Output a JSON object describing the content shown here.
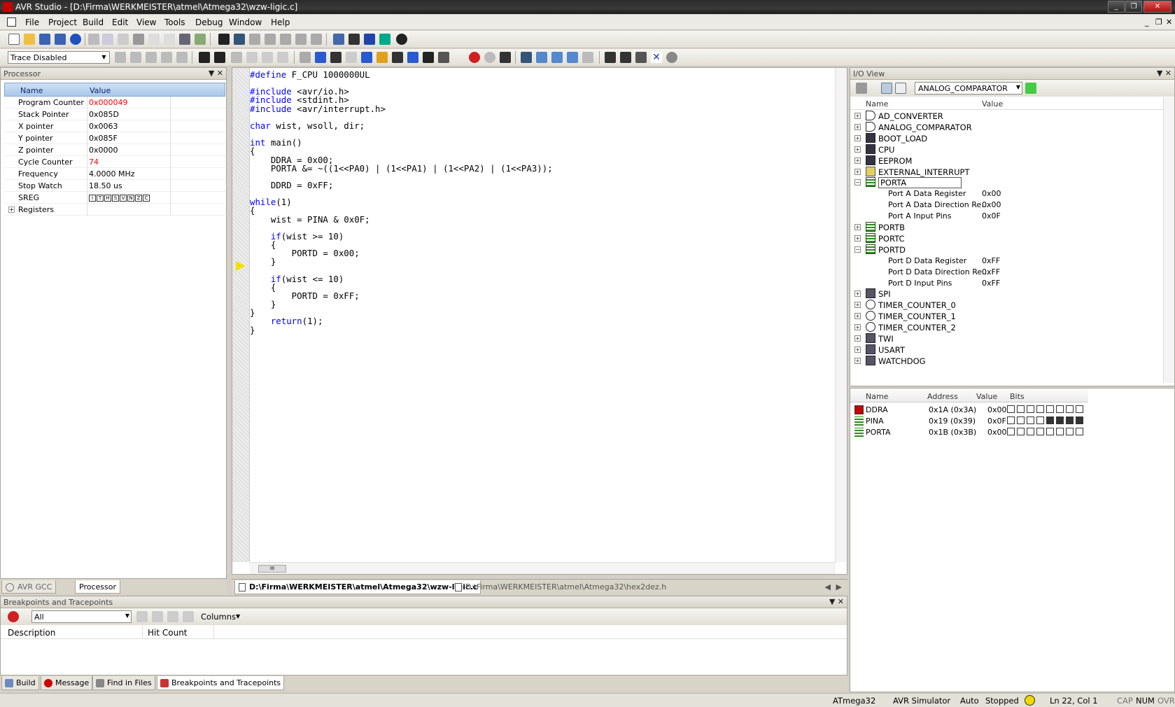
{
  "window": {
    "title": "AVR Studio - [D:\\Firma\\WERKMEISTER\\atmel\\Atmega32\\wzw-ligic.c]",
    "controls": [
      "_",
      "❐",
      "✕"
    ],
    "mdi_controls": [
      "_",
      "❐",
      "✕"
    ]
  },
  "menu": [
    "File",
    "Project",
    "Build",
    "Edit",
    "View",
    "Tools",
    "Debug",
    "Window",
    "Help"
  ],
  "toolbar": {
    "trace_mode": "Trace Disabled",
    "icons": [
      "new-file-icon",
      "open-icon",
      "save-icon",
      "save-all-icon",
      "undo-icon",
      "cut-icon",
      "copy-icon",
      "paste-icon",
      "print-icon",
      "find-icon",
      "build-icon",
      "run-icon",
      "stop-icon",
      "step-icon",
      "breakpoint-icon"
    ]
  },
  "processor": {
    "title": "Processor",
    "columns": [
      "Name",
      "Value"
    ],
    "rows": [
      {
        "name": "Program Counter",
        "value": "0x000049",
        "changed": true
      },
      {
        "name": "Stack Pointer",
        "value": "0x085D",
        "changed": false
      },
      {
        "name": "X pointer",
        "value": "0x0063",
        "changed": false
      },
      {
        "name": "Y pointer",
        "value": "0x085F",
        "changed": false
      },
      {
        "name": "Z pointer",
        "value": "0x0000",
        "changed": false
      },
      {
        "name": "Cycle Counter",
        "value": "74",
        "changed": true
      },
      {
        "name": "Frequency",
        "value": "4.0000 MHz",
        "changed": false
      },
      {
        "name": "Stop Watch",
        "value": "18.50 us",
        "changed": false
      },
      {
        "name": "SREG",
        "value": "",
        "changed": false
      },
      {
        "name": "Registers",
        "value": "",
        "changed": false
      }
    ],
    "sreg_flags": [
      "I",
      "T",
      "H",
      "S",
      "V",
      "N",
      "Z",
      "C"
    ]
  },
  "left_tabs": [
    "AVR GCC",
    "Processor"
  ],
  "editor": {
    "code_lines": [
      {
        "text": "#define F_CPU 1000000UL",
        "kind": "pp"
      },
      {
        "text": "",
        "kind": ""
      },
      {
        "text": "#include <avr/io.h>",
        "kind": "pp"
      },
      {
        "text": "#include <stdint.h>",
        "kind": "pp"
      },
      {
        "text": "#include <avr/interrupt.h>",
        "kind": "pp"
      },
      {
        "text": "",
        "kind": ""
      },
      {
        "text": "char wist, wsoll, dir;",
        "kind": "decl"
      },
      {
        "text": "",
        "kind": ""
      },
      {
        "text": "int main()",
        "kind": "decl"
      },
      {
        "text": "{",
        "kind": ""
      },
      {
        "text": "    DDRA = 0x00;",
        "kind": ""
      },
      {
        "text": "    PORTA &= ~((1<<PA0) | (1<<PA1) | (1<<PA2) | (1<<PA3));",
        "kind": ""
      },
      {
        "text": "",
        "kind": ""
      },
      {
        "text": "    DDRD = 0xFF;",
        "kind": ""
      },
      {
        "text": "",
        "kind": ""
      },
      {
        "text": "while(1)",
        "kind": "while"
      },
      {
        "text": "{",
        "kind": ""
      },
      {
        "text": "    wist = PINA & 0x0F;",
        "kind": ""
      },
      {
        "text": "",
        "kind": ""
      },
      {
        "text": "    if(wist >= 10)",
        "kind": "if"
      },
      {
        "text": "    {",
        "kind": ""
      },
      {
        "text": "        PORTD = 0x00;",
        "kind": ""
      },
      {
        "text": "    }",
        "kind": ""
      },
      {
        "text": "",
        "kind": ""
      },
      {
        "text": "    if(wist <= 10)",
        "kind": "if"
      },
      {
        "text": "    {",
        "kind": ""
      },
      {
        "text": "        PORTD = 0xFF;",
        "kind": ""
      },
      {
        "text": "    }",
        "kind": ""
      },
      {
        "text": "}",
        "kind": ""
      },
      {
        "text": "    return(1);",
        "kind": "return"
      },
      {
        "text": "}",
        "kind": ""
      }
    ],
    "tabs": [
      "D:\\Firma\\WERKMEISTER\\atmel\\Atmega32\\wzw-ligic.c",
      "D:\\Firma\\WERKMEISTER\\atmel\\Atmega32\\hex2dez.h"
    ]
  },
  "io_view": {
    "title": "I/O View",
    "selected_module": "ANALOG_COMPARATOR",
    "columns": [
      "Name",
      "Value"
    ],
    "tree": [
      {
        "label": "AD_CONVERTER",
        "expanded": false,
        "icon": "adc-icon"
      },
      {
        "label": "ANALOG_COMPARATOR",
        "expanded": false,
        "icon": "comparator-icon"
      },
      {
        "label": "BOOT_LOAD",
        "expanded": false,
        "icon": "bootload-icon"
      },
      {
        "label": "CPU",
        "expanded": false,
        "icon": "cpu-icon"
      },
      {
        "label": "EEPROM",
        "expanded": false,
        "icon": "eeprom-icon"
      },
      {
        "label": "EXTERNAL_INTERRUPT",
        "expanded": false,
        "icon": "interrupt-icon"
      },
      {
        "label": "PORTA",
        "expanded": true,
        "icon": "port-icon",
        "children": [
          {
            "label": "Port A Data Register",
            "value": "0x00"
          },
          {
            "label": "Port A Data Direction Re...",
            "value": "0x00"
          },
          {
            "label": "Port A Input Pins",
            "value": "0x0F"
          }
        ]
      },
      {
        "label": "PORTB",
        "expanded": false,
        "icon": "port-icon"
      },
      {
        "label": "PORTC",
        "expanded": false,
        "icon": "port-icon"
      },
      {
        "label": "PORTD",
        "expanded": true,
        "icon": "port-icon",
        "children": [
          {
            "label": "Port D Data Register",
            "value": "0xFF"
          },
          {
            "label": "Port D Data Direction Re...",
            "value": "0xFF"
          },
          {
            "label": "Port D Input Pins",
            "value": "0xFF"
          }
        ]
      },
      {
        "label": "SPI",
        "expanded": false,
        "icon": "spi-icon"
      },
      {
        "label": "TIMER_COUNTER_0",
        "expanded": false,
        "icon": "timer-icon"
      },
      {
        "label": "TIMER_COUNTER_1",
        "expanded": false,
        "icon": "timer-icon"
      },
      {
        "label": "TIMER_COUNTER_2",
        "expanded": false,
        "icon": "timer-icon"
      },
      {
        "label": "TWI",
        "expanded": false,
        "icon": "twi-icon"
      },
      {
        "label": "USART",
        "expanded": false,
        "icon": "usart-icon"
      },
      {
        "label": "WATCHDOG",
        "expanded": false,
        "icon": "watchdog-icon"
      }
    ],
    "register_columns": [
      "Name",
      "Address",
      "Value",
      "Bits"
    ],
    "registers": [
      {
        "name": "DDRA",
        "address": "0x1A (0x3A)",
        "value": "0x00",
        "bits": [
          0,
          0,
          0,
          0,
          0,
          0,
          0,
          0
        ]
      },
      {
        "name": "PINA",
        "address": "0x19 (0x39)",
        "value": "0x0F",
        "bits": [
          0,
          0,
          0,
          0,
          1,
          1,
          1,
          1
        ]
      },
      {
        "name": "PORTA",
        "address": "0x1B (0x3B)",
        "value": "0x00",
        "bits": [
          0,
          0,
          0,
          0,
          0,
          0,
          0,
          0
        ]
      }
    ]
  },
  "breakpoints": {
    "title": "Breakpoints and Tracepoints",
    "filter": "All",
    "columns_button": "Columns",
    "columns": [
      "Description",
      "Hit Count"
    ]
  },
  "bottom_tabs": [
    "Build",
    "Message",
    "Find in Files",
    "Breakpoints and Tracepoints"
  ],
  "status": {
    "device": "ATmega32",
    "platform": "AVR Simulator",
    "mode": "Auto",
    "state": "Stopped",
    "position": "Ln 22, Col 1",
    "cap": "CAP",
    "num": "NUM",
    "ovr": "OVR"
  },
  "colors": {
    "changed_value": "#ff0000",
    "keyword": "#0000ff",
    "exec_arrow": "#f1e000",
    "port_icon": "#2e8b1f"
  }
}
